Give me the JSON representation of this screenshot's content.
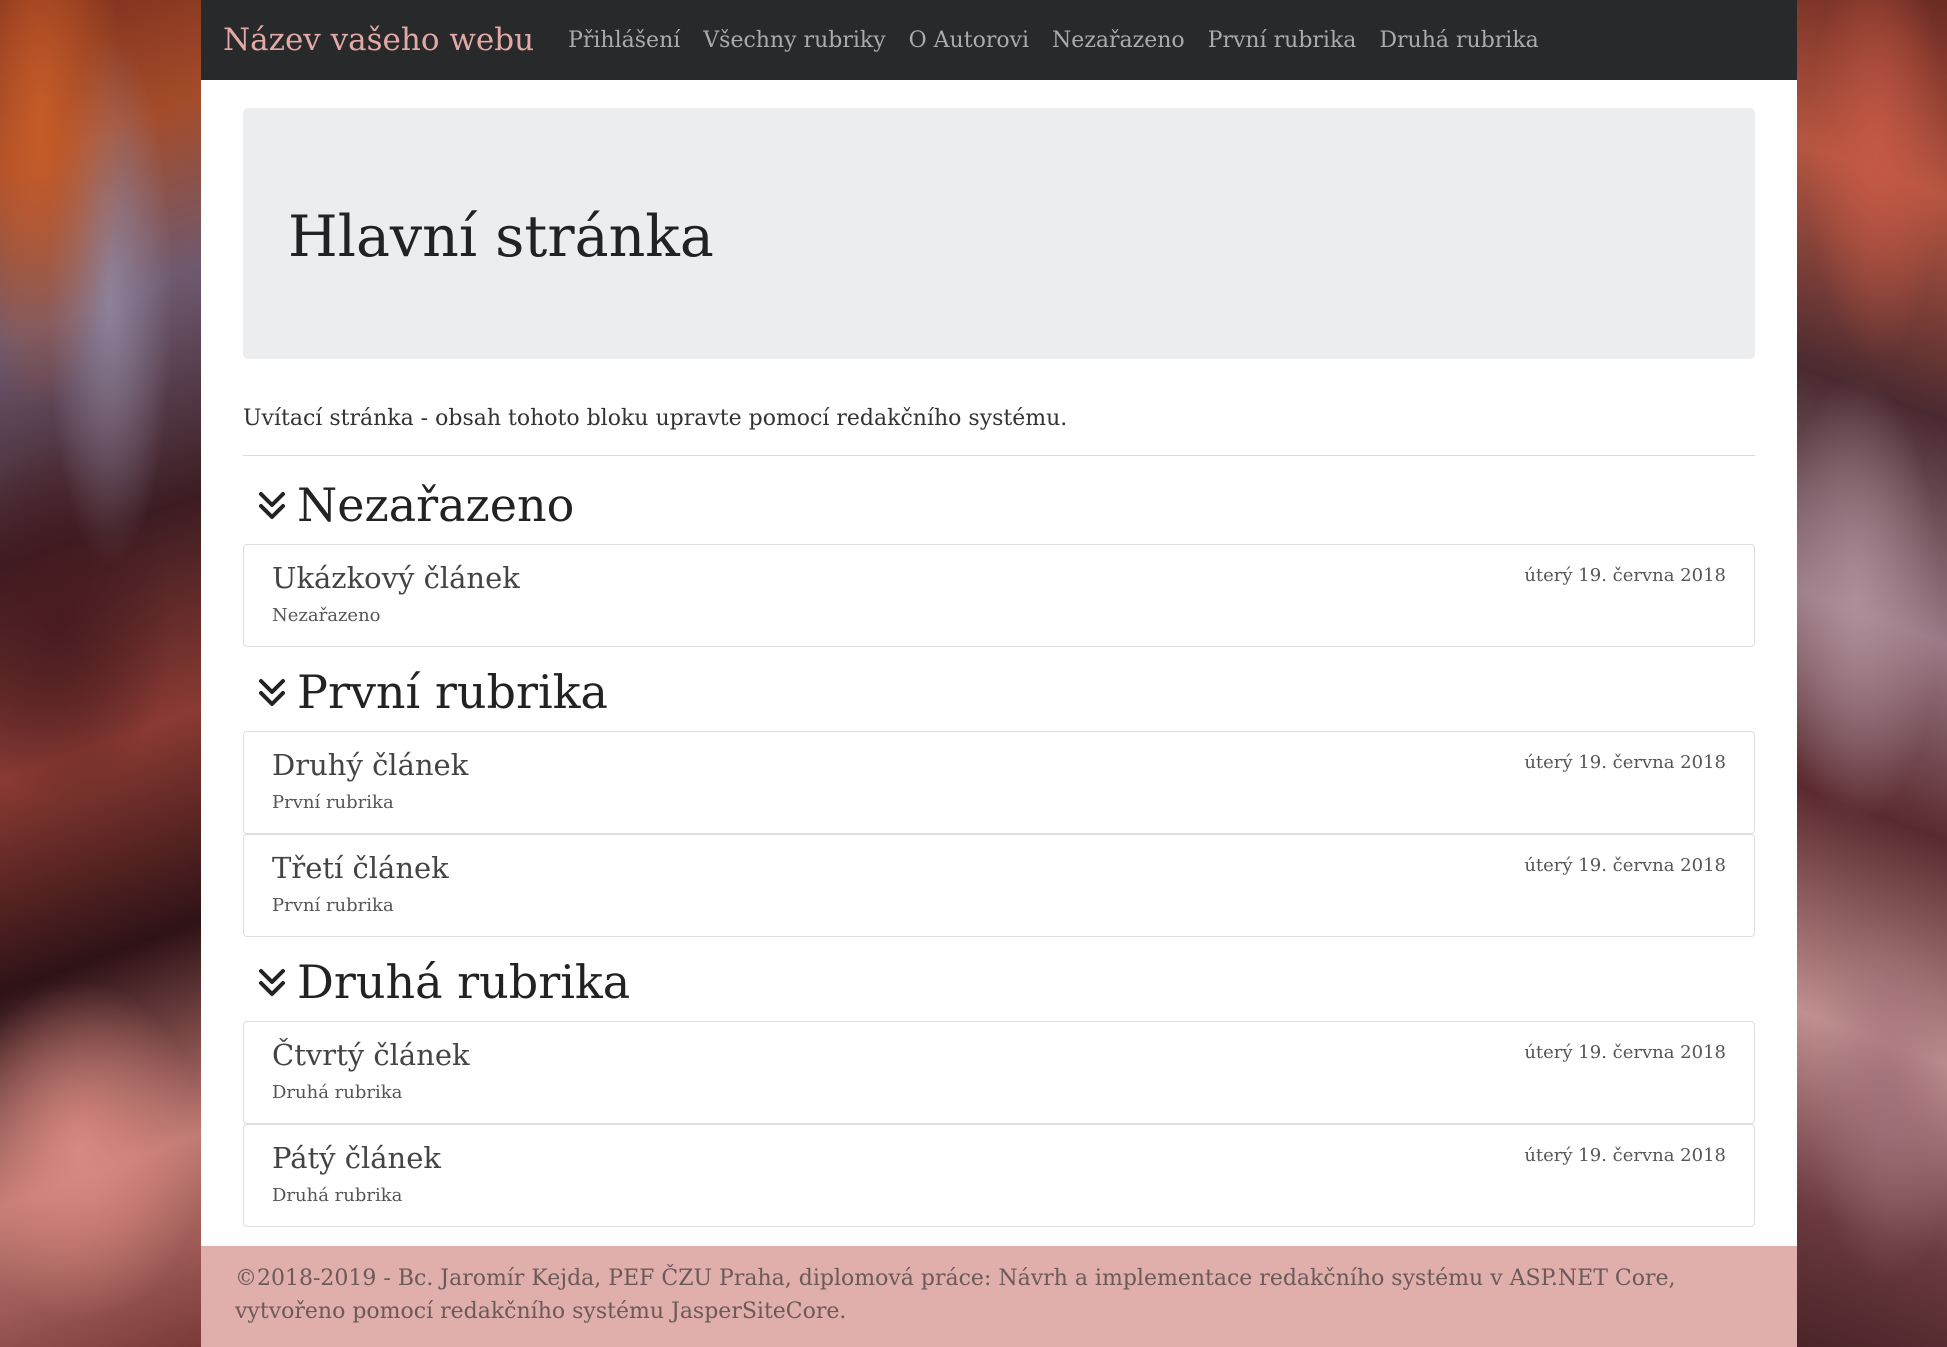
{
  "navbar": {
    "brand": "Název vašeho webu",
    "items": [
      {
        "label": "Přihlášení"
      },
      {
        "label": "Všechny rubriky"
      },
      {
        "label": "O Autorovi"
      },
      {
        "label": "Nezařazeno"
      },
      {
        "label": "První rubrika"
      },
      {
        "label": "Druhá rubrika"
      }
    ]
  },
  "page": {
    "title": "Hlavní stránka",
    "intro": "Uvítací stránka - obsah tohoto bloku upravte pomocí redakčního systému."
  },
  "sections": [
    {
      "title": "Nezařazeno",
      "icon": "chevron-double-down-icon",
      "articles": [
        {
          "title": "Ukázkový článek",
          "category": "Nezařazeno",
          "date": "úterý 19. června 2018"
        }
      ]
    },
    {
      "title": "První rubrika",
      "icon": "chevron-double-down-icon",
      "articles": [
        {
          "title": "Druhý článek",
          "category": "První rubrika",
          "date": "úterý 19. června 2018"
        },
        {
          "title": "Třetí článek",
          "category": "První rubrika",
          "date": "úterý 19. června 2018"
        }
      ]
    },
    {
      "title": "Druhá rubrika",
      "icon": "chevron-double-down-icon",
      "articles": [
        {
          "title": "Čtvrtý článek",
          "category": "Druhá rubrika",
          "date": "úterý 19. června 2018"
        },
        {
          "title": "Pátý článek",
          "category": "Druhá rubrika",
          "date": "úterý 19. června 2018"
        }
      ]
    }
  ],
  "footer": {
    "text": "©2018-2019 - Bc. Jaromír Kejda, PEF ČZU Praha, diplomová práce: Návrh a implementace redakčního systému v ASP.NET Core, vytvořeno pomocí redakčního systému JasperSiteCore."
  },
  "colors": {
    "navbar_bg": "#27292b",
    "brand": "#e6a8a4",
    "nav_link": "#a9abae",
    "jumbotron_bg": "#ecedee",
    "footer_bg": "#e0aeab"
  }
}
